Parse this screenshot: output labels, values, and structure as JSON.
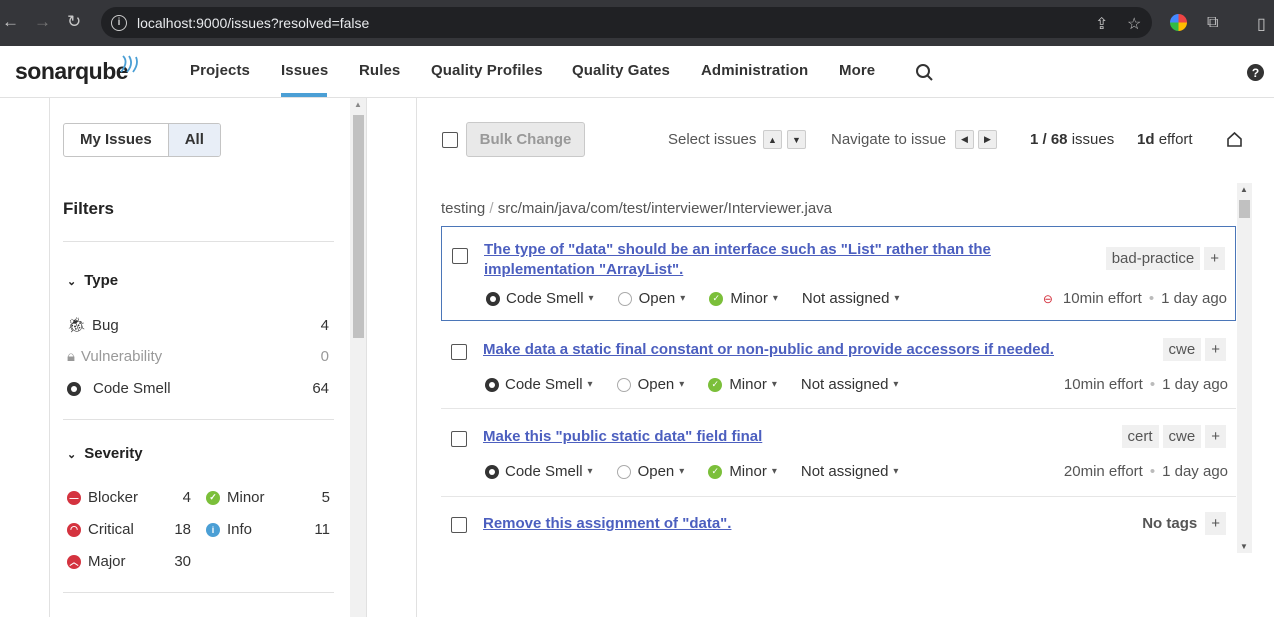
{
  "browser": {
    "url": "localhost:9000/issues?resolved=false"
  },
  "nav": {
    "logo": "sonarqube",
    "items": [
      "Projects",
      "Issues",
      "Rules",
      "Quality Profiles",
      "Quality Gates",
      "Administration",
      "More"
    ]
  },
  "sidebar": {
    "my_issues": "My Issues",
    "all": "All",
    "filters_title": "Filters",
    "type": {
      "title": "Type",
      "items": [
        {
          "label": "Bug",
          "count": "4"
        },
        {
          "label": "Vulnerability",
          "count": "0"
        },
        {
          "label": "Code Smell",
          "count": "64"
        }
      ]
    },
    "severity": {
      "title": "Severity",
      "items": [
        {
          "label": "Blocker",
          "count": "4",
          "color": "#d4333f"
        },
        {
          "label": "Minor",
          "count": "5",
          "color": "#7bbf3a"
        },
        {
          "label": "Critical",
          "count": "18",
          "color": "#d4333f"
        },
        {
          "label": "Info",
          "count": "11",
          "color": "#4b9fd5"
        },
        {
          "label": "Major",
          "count": "30",
          "color": "#d4333f"
        }
      ]
    }
  },
  "toolbar": {
    "bulk": "Bulk Change",
    "select": "Select issues",
    "navigate": "Navigate to issue",
    "count": "1 / 68",
    "count_label": "issues",
    "effort": "1d",
    "effort_label": "effort"
  },
  "breadcrumb": {
    "project": "testing",
    "path": "src/main/java/com/test/interviewer/Interviewer.java"
  },
  "issues": [
    {
      "title": "The type of \"data\" should be an interface such as \"List\" rather than the implementation \"ArrayList\".",
      "tags": [
        "bad-practice"
      ],
      "type": "Code Smell",
      "status": "Open",
      "severity": "Minor",
      "assignee": "Not assigned",
      "effort": "10min effort",
      "age": "1 day ago"
    },
    {
      "title": "Make data a static final constant or non-public and provide accessors if needed.",
      "tags": [
        "cwe"
      ],
      "type": "Code Smell",
      "status": "Open",
      "severity": "Minor",
      "assignee": "Not assigned",
      "effort": "10min effort",
      "age": "1 day ago"
    },
    {
      "title": "Make this \"public static data\" field final",
      "tags": [
        "cert",
        "cwe"
      ],
      "type": "Code Smell",
      "status": "Open",
      "severity": "Minor",
      "assignee": "Not assigned",
      "effort": "20min effort",
      "age": "1 day ago"
    },
    {
      "title": "Remove this assignment of \"data\".",
      "notags": "No tags"
    }
  ]
}
